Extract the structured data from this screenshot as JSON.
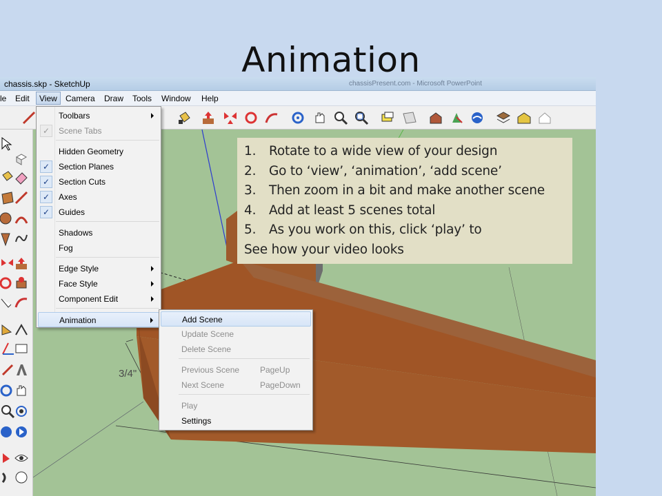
{
  "slide": {
    "title": "Animation"
  },
  "window": {
    "title": "chassis.skp - SketchUp",
    "background_title": "chassisPresent.com - Microsoft PowerPoint"
  },
  "menubar": [
    {
      "label": "le"
    },
    {
      "label": "Edit"
    },
    {
      "label": "View"
    },
    {
      "label": "Camera"
    },
    {
      "label": "Draw"
    },
    {
      "label": "Tools"
    },
    {
      "label": "Window"
    },
    {
      "label": "Help"
    }
  ],
  "view_menu": {
    "items": [
      {
        "label": "Toolbars",
        "submenu": true
      },
      {
        "label": "Scene Tabs",
        "checked": true,
        "disabled": true
      },
      {
        "label": "Hidden Geometry"
      },
      {
        "label": "Section Planes",
        "checked": true
      },
      {
        "label": "Section Cuts",
        "checked": true
      },
      {
        "label": "Axes",
        "checked": true
      },
      {
        "label": "Guides",
        "checked": true
      },
      {
        "label": "Shadows"
      },
      {
        "label": "Fog"
      },
      {
        "label": "Edge Style",
        "submenu": true
      },
      {
        "label": "Face Style",
        "submenu": true
      },
      {
        "label": "Component Edit",
        "submenu": true
      },
      {
        "label": "Animation",
        "submenu": true,
        "highlighted": true
      }
    ]
  },
  "animation_menu": {
    "items": [
      {
        "label": "Add Scene",
        "highlighted": true
      },
      {
        "label": "Update Scene",
        "disabled": true
      },
      {
        "label": "Delete Scene",
        "disabled": true
      },
      {
        "label": "Previous Scene",
        "shortcut": "PageUp",
        "disabled": true
      },
      {
        "label": "Next Scene",
        "shortcut": "PageDown",
        "disabled": true
      },
      {
        "label": "Play",
        "disabled": true
      },
      {
        "label": "Settings"
      }
    ]
  },
  "viewport": {
    "dimension_label": "3/4\""
  },
  "instructions": {
    "steps": [
      {
        "num": "1.",
        "text": "Rotate to a wide view of your design"
      },
      {
        "num": "2.",
        "text": "Go to ‘view’, ‘animation’, ‘add scene’"
      },
      {
        "num": "3.",
        "text": "Then zoom in a bit and make another scene"
      },
      {
        "num": "4.",
        "text": "Add at least 5 scenes total"
      },
      {
        "num": "5.",
        "text": "As you work on this, click ‘play’ to"
      }
    ],
    "tail": "See how your video looks"
  },
  "colors": {
    "slide_bg": "#c8d9ef",
    "viewport_bg": "#a3c396",
    "wood": "#a55a28",
    "note_bg": "#e2dfc6",
    "menu_highlight": "#d7e5f7"
  }
}
